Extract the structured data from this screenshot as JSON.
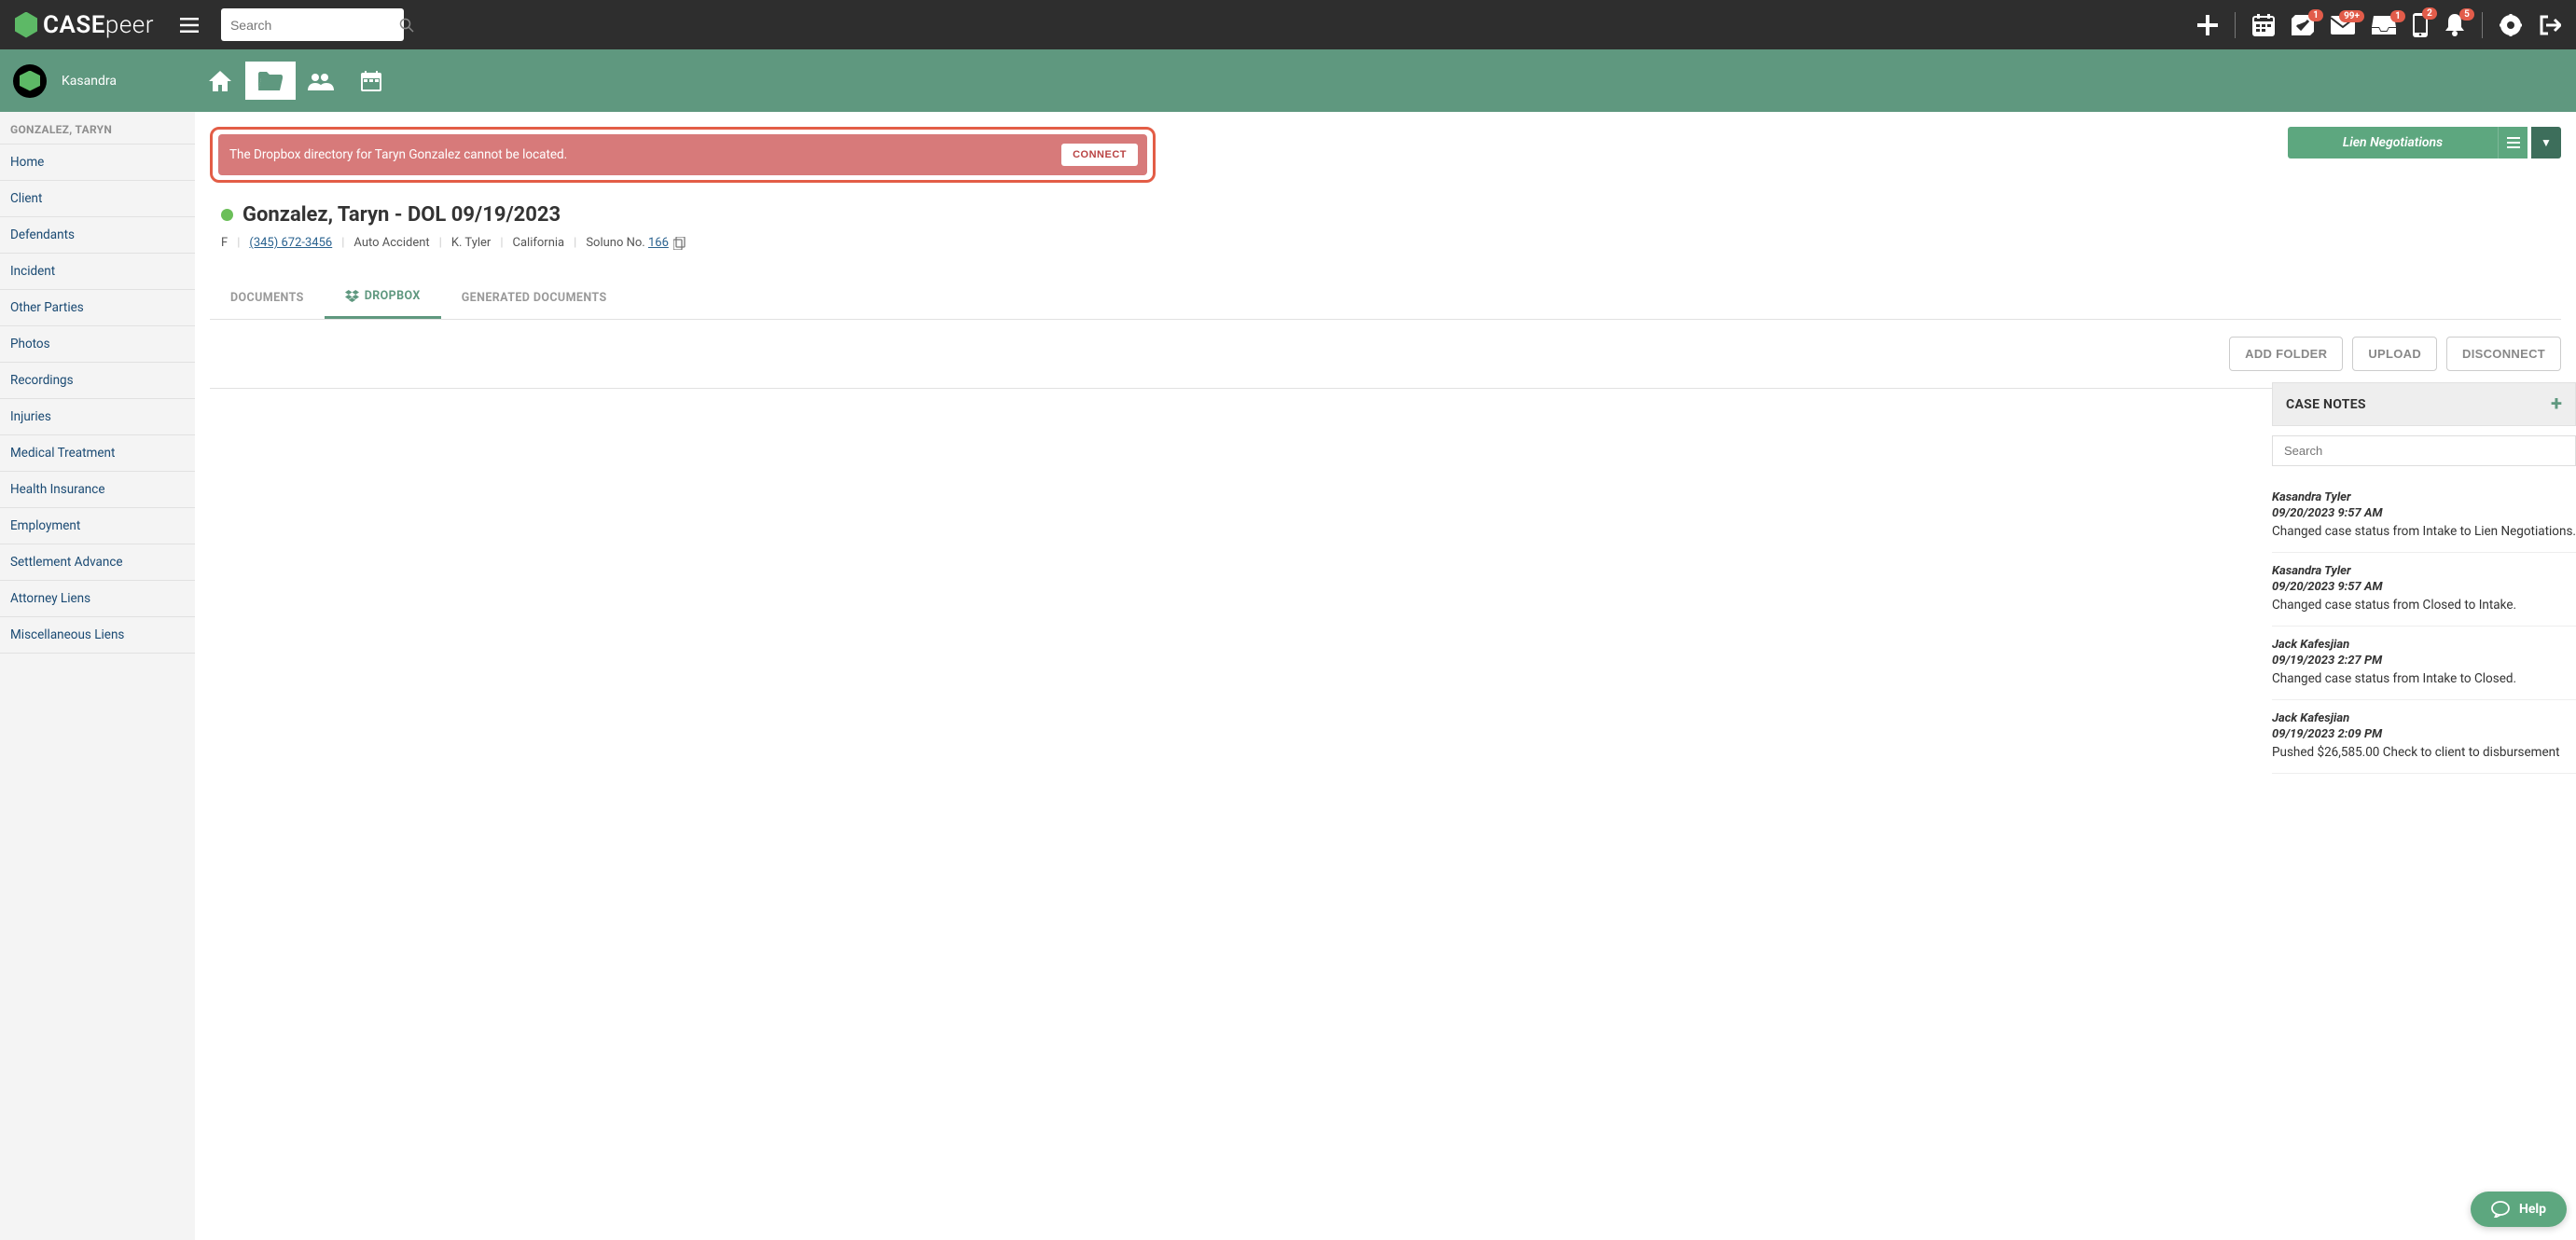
{
  "brand": {
    "name_a": "CASE",
    "name_b": "peer"
  },
  "search": {
    "placeholder": "Search"
  },
  "user": {
    "name": "Kasandra"
  },
  "badges": {
    "checkbox": "1",
    "mail": "99+",
    "inbox": "1",
    "mobile": "2",
    "bell": "5"
  },
  "sidebar": {
    "category": "GONZALEZ, TARYN",
    "items": [
      "Home",
      "Client",
      "Defendants",
      "Incident",
      "Other Parties",
      "Photos",
      "Recordings",
      "Injuries",
      "Medical Treatment",
      "Health Insurance",
      "Employment",
      "Settlement Advance",
      "Attorney Liens",
      "Miscellaneous Liens"
    ]
  },
  "alert": {
    "text": "The Dropbox directory for Taryn Gonzalez cannot be located.",
    "button": "CONNECT"
  },
  "status": {
    "label": "Lien Negotiations"
  },
  "case": {
    "title": "Gonzalez, Taryn - DOL 09/19/2023",
    "gender": "F",
    "phone": "(345) 672-3456",
    "type": "Auto Accident",
    "attorney": "K. Tyler",
    "state": "California",
    "soluno_label": "Soluno No.",
    "soluno_no": "166"
  },
  "tabs": {
    "documents": "DOCUMENTS",
    "dropbox": "DROPBOX",
    "generated": "GENERATED DOCUMENTS"
  },
  "actions": {
    "add_folder": "ADD FOLDER",
    "upload": "UPLOAD",
    "disconnect": "DISCONNECT"
  },
  "case_notes": {
    "title": "CASE NOTES",
    "search_placeholder": "Search",
    "items": [
      {
        "author": "Kasandra Tyler",
        "date": "09/20/2023 9:57 AM",
        "text": "Changed case status from Intake to Lien Negotiations."
      },
      {
        "author": "Kasandra Tyler",
        "date": "09/20/2023 9:57 AM",
        "text": "Changed case status from Closed to Intake."
      },
      {
        "author": "Jack Kafesjian",
        "date": "09/19/2023 2:27 PM",
        "text": "Changed case status from Intake to Closed."
      },
      {
        "author": "Jack Kafesjian",
        "date": "09/19/2023 2:09 PM",
        "text": "Pushed $26,585.00 Check to client to disbursement"
      }
    ]
  },
  "help": {
    "label": "Help"
  }
}
